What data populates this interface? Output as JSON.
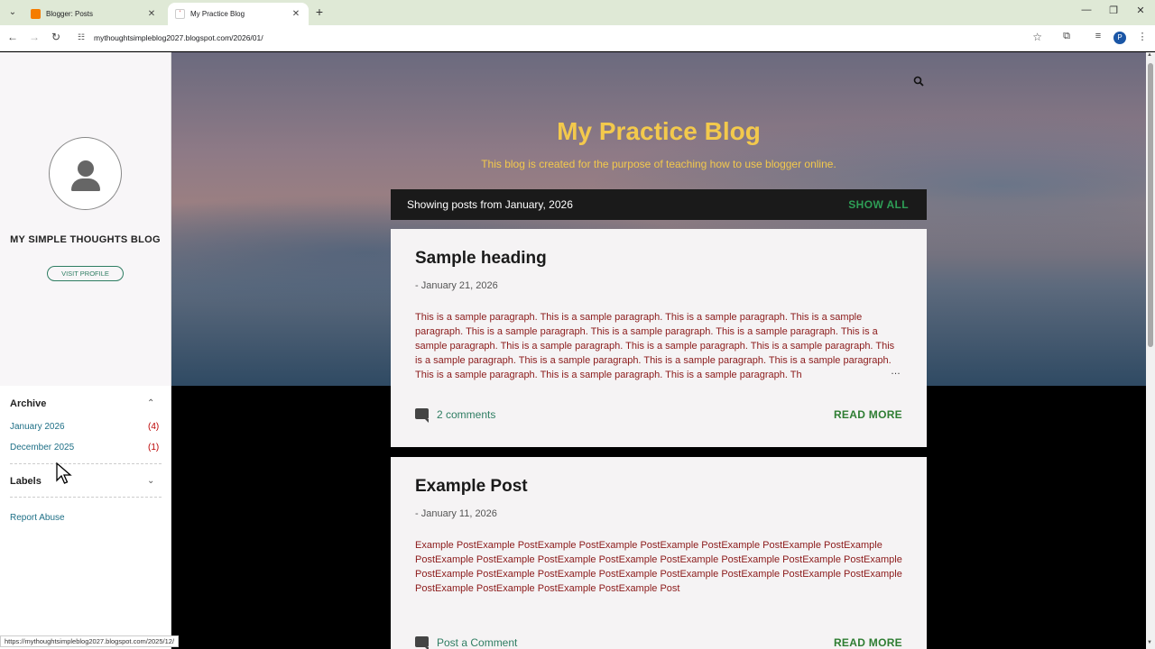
{
  "browser": {
    "tabs": [
      {
        "label": "Blogger: Posts",
        "active": false
      },
      {
        "label": "My Practice Blog",
        "active": true
      }
    ],
    "url": "mythoughtsimpleblog2027.blogspot.com/2026/01/",
    "profile_initial": "P",
    "status_url": "https://mythoughtsimpleblog2027.blogspot.com/2025/12/"
  },
  "sidebar": {
    "blog_name": "MY SIMPLE THOUGHTS BLOG",
    "visit_profile": "VISIT PROFILE",
    "archive": {
      "title": "Archive",
      "items": [
        {
          "label": "January 2026",
          "count": "(4)"
        },
        {
          "label": "December 2025",
          "count": "(1)"
        }
      ]
    },
    "labels_title": "Labels",
    "report_abuse": "Report Abuse"
  },
  "header": {
    "title": "My Practice Blog",
    "description": "This blog is created for the purpose of teaching how to use blogger online."
  },
  "filter": {
    "text": "Showing posts from January, 2026",
    "show_all": "SHOW ALL"
  },
  "posts": [
    {
      "title": "Sample heading",
      "date": "- January 21, 2026",
      "body": "This is a sample paragraph. This is a sample paragraph. This is a sample paragraph. This is a sample paragraph. This is a sample paragraph. This is a sample paragraph. This is a sample paragraph. This is a sample paragraph. This is a sample paragraph. This is a sample paragraph. This is a sample paragraph. This is a sample paragraph. This is a sample paragraph. This is a sample paragraph. This is a sample paragraph. This is a sample paragraph. This is a sample paragraph. This is a sample paragraph. Th",
      "ellipsis": "…",
      "comments": "2 comments",
      "read_more": "READ MORE"
    },
    {
      "title": "Example Post",
      "date": "- January 11, 2026",
      "body": " Example PostExample PostExample PostExample PostExample PostExample PostExample PostExample PostExample PostExample PostExample PostExample PostExample PostExample PostExample PostExample PostExample PostExample PostExample PostExample PostExample PostExample PostExample PostExample PostExample PostExample PostExample PostExample Post",
      "comments": "Post a Comment",
      "read_more": "READ MORE"
    }
  ],
  "colors": {
    "accent_gold": "#f3c94c",
    "link_green": "#2e7d32",
    "body_red": "#8b1a1a"
  }
}
